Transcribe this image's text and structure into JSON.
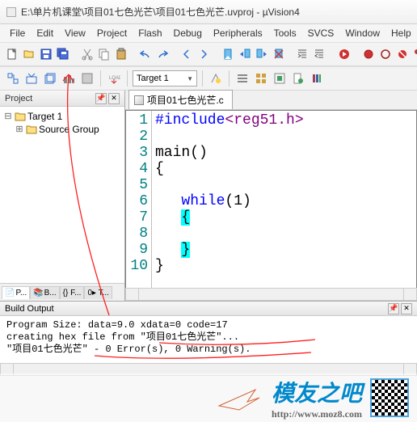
{
  "title": "E:\\单片机课堂\\项目01七色光芒\\项目01七色光芒.uvproj - µVision4",
  "menu": [
    "File",
    "Edit",
    "View",
    "Project",
    "Flash",
    "Debug",
    "Peripherals",
    "Tools",
    "SVCS",
    "Window",
    "Help"
  ],
  "toolbar2_combo": "Target 1",
  "project": {
    "title": "Project",
    "target": "Target 1",
    "group": "Source Group"
  },
  "panel_tabs": {
    "a": "P...",
    "b": "B...",
    "c": "{} F...",
    "d": "0▸ T..."
  },
  "code_tab": "项目01七色光芒.c",
  "code_lines": {
    "l1_pre": "#include",
    "l1_hdr": "<reg51.h>",
    "l3": "main()",
    "l4": "{",
    "l6_pre": "   ",
    "l6_kw": "while",
    "l6_post": "(1)",
    "l7_pre": "   ",
    "l7_br": "{",
    "l9_pre": "   ",
    "l9_br": "}",
    "l10": "}"
  },
  "gutter_lines": [
    "1",
    "2",
    "3",
    "4",
    "5",
    "6",
    "7",
    "8",
    "9",
    "10"
  ],
  "build_output": {
    "title": "Build Output",
    "line1": "Program Size: data=9.0 xdata=0 code=17",
    "line2": "creating hex file from \"项目01七色光芒\"...",
    "line3": "\"项目01七色光芒\" - 0 Error(s), 0 Warning(s)."
  },
  "watermark": {
    "logo": "模友之吧",
    "url": "http://www.moz8.com"
  }
}
